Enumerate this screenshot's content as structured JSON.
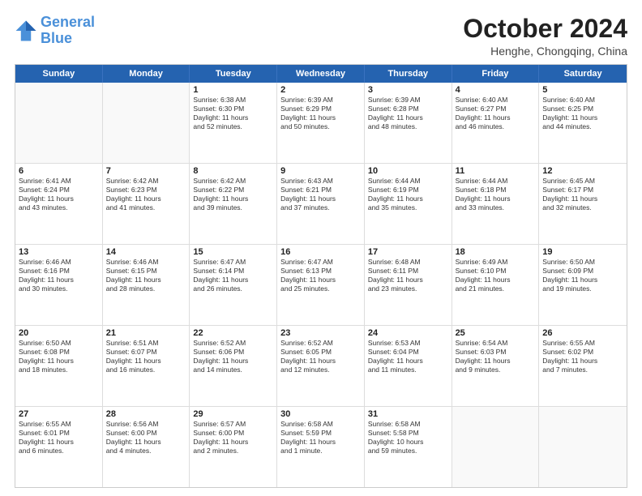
{
  "logo": {
    "general": "General",
    "blue": "Blue"
  },
  "title": "October 2024",
  "subtitle": "Henghe, Chongqing, China",
  "header_days": [
    "Sunday",
    "Monday",
    "Tuesday",
    "Wednesday",
    "Thursday",
    "Friday",
    "Saturday"
  ],
  "weeks": [
    [
      {
        "day": "",
        "lines": []
      },
      {
        "day": "",
        "lines": []
      },
      {
        "day": "1",
        "lines": [
          "Sunrise: 6:38 AM",
          "Sunset: 6:30 PM",
          "Daylight: 11 hours",
          "and 52 minutes."
        ]
      },
      {
        "day": "2",
        "lines": [
          "Sunrise: 6:39 AM",
          "Sunset: 6:29 PM",
          "Daylight: 11 hours",
          "and 50 minutes."
        ]
      },
      {
        "day": "3",
        "lines": [
          "Sunrise: 6:39 AM",
          "Sunset: 6:28 PM",
          "Daylight: 11 hours",
          "and 48 minutes."
        ]
      },
      {
        "day": "4",
        "lines": [
          "Sunrise: 6:40 AM",
          "Sunset: 6:27 PM",
          "Daylight: 11 hours",
          "and 46 minutes."
        ]
      },
      {
        "day": "5",
        "lines": [
          "Sunrise: 6:40 AM",
          "Sunset: 6:25 PM",
          "Daylight: 11 hours",
          "and 44 minutes."
        ]
      }
    ],
    [
      {
        "day": "6",
        "lines": [
          "Sunrise: 6:41 AM",
          "Sunset: 6:24 PM",
          "Daylight: 11 hours",
          "and 43 minutes."
        ]
      },
      {
        "day": "7",
        "lines": [
          "Sunrise: 6:42 AM",
          "Sunset: 6:23 PM",
          "Daylight: 11 hours",
          "and 41 minutes."
        ]
      },
      {
        "day": "8",
        "lines": [
          "Sunrise: 6:42 AM",
          "Sunset: 6:22 PM",
          "Daylight: 11 hours",
          "and 39 minutes."
        ]
      },
      {
        "day": "9",
        "lines": [
          "Sunrise: 6:43 AM",
          "Sunset: 6:21 PM",
          "Daylight: 11 hours",
          "and 37 minutes."
        ]
      },
      {
        "day": "10",
        "lines": [
          "Sunrise: 6:44 AM",
          "Sunset: 6:19 PM",
          "Daylight: 11 hours",
          "and 35 minutes."
        ]
      },
      {
        "day": "11",
        "lines": [
          "Sunrise: 6:44 AM",
          "Sunset: 6:18 PM",
          "Daylight: 11 hours",
          "and 33 minutes."
        ]
      },
      {
        "day": "12",
        "lines": [
          "Sunrise: 6:45 AM",
          "Sunset: 6:17 PM",
          "Daylight: 11 hours",
          "and 32 minutes."
        ]
      }
    ],
    [
      {
        "day": "13",
        "lines": [
          "Sunrise: 6:46 AM",
          "Sunset: 6:16 PM",
          "Daylight: 11 hours",
          "and 30 minutes."
        ]
      },
      {
        "day": "14",
        "lines": [
          "Sunrise: 6:46 AM",
          "Sunset: 6:15 PM",
          "Daylight: 11 hours",
          "and 28 minutes."
        ]
      },
      {
        "day": "15",
        "lines": [
          "Sunrise: 6:47 AM",
          "Sunset: 6:14 PM",
          "Daylight: 11 hours",
          "and 26 minutes."
        ]
      },
      {
        "day": "16",
        "lines": [
          "Sunrise: 6:47 AM",
          "Sunset: 6:13 PM",
          "Daylight: 11 hours",
          "and 25 minutes."
        ]
      },
      {
        "day": "17",
        "lines": [
          "Sunrise: 6:48 AM",
          "Sunset: 6:11 PM",
          "Daylight: 11 hours",
          "and 23 minutes."
        ]
      },
      {
        "day": "18",
        "lines": [
          "Sunrise: 6:49 AM",
          "Sunset: 6:10 PM",
          "Daylight: 11 hours",
          "and 21 minutes."
        ]
      },
      {
        "day": "19",
        "lines": [
          "Sunrise: 6:50 AM",
          "Sunset: 6:09 PM",
          "Daylight: 11 hours",
          "and 19 minutes."
        ]
      }
    ],
    [
      {
        "day": "20",
        "lines": [
          "Sunrise: 6:50 AM",
          "Sunset: 6:08 PM",
          "Daylight: 11 hours",
          "and 18 minutes."
        ]
      },
      {
        "day": "21",
        "lines": [
          "Sunrise: 6:51 AM",
          "Sunset: 6:07 PM",
          "Daylight: 11 hours",
          "and 16 minutes."
        ]
      },
      {
        "day": "22",
        "lines": [
          "Sunrise: 6:52 AM",
          "Sunset: 6:06 PM",
          "Daylight: 11 hours",
          "and 14 minutes."
        ]
      },
      {
        "day": "23",
        "lines": [
          "Sunrise: 6:52 AM",
          "Sunset: 6:05 PM",
          "Daylight: 11 hours",
          "and 12 minutes."
        ]
      },
      {
        "day": "24",
        "lines": [
          "Sunrise: 6:53 AM",
          "Sunset: 6:04 PM",
          "Daylight: 11 hours",
          "and 11 minutes."
        ]
      },
      {
        "day": "25",
        "lines": [
          "Sunrise: 6:54 AM",
          "Sunset: 6:03 PM",
          "Daylight: 11 hours",
          "and 9 minutes."
        ]
      },
      {
        "day": "26",
        "lines": [
          "Sunrise: 6:55 AM",
          "Sunset: 6:02 PM",
          "Daylight: 11 hours",
          "and 7 minutes."
        ]
      }
    ],
    [
      {
        "day": "27",
        "lines": [
          "Sunrise: 6:55 AM",
          "Sunset: 6:01 PM",
          "Daylight: 11 hours",
          "and 6 minutes."
        ]
      },
      {
        "day": "28",
        "lines": [
          "Sunrise: 6:56 AM",
          "Sunset: 6:00 PM",
          "Daylight: 11 hours",
          "and 4 minutes."
        ]
      },
      {
        "day": "29",
        "lines": [
          "Sunrise: 6:57 AM",
          "Sunset: 6:00 PM",
          "Daylight: 11 hours",
          "and 2 minutes."
        ]
      },
      {
        "day": "30",
        "lines": [
          "Sunrise: 6:58 AM",
          "Sunset: 5:59 PM",
          "Daylight: 11 hours",
          "and 1 minute."
        ]
      },
      {
        "day": "31",
        "lines": [
          "Sunrise: 6:58 AM",
          "Sunset: 5:58 PM",
          "Daylight: 10 hours",
          "and 59 minutes."
        ]
      },
      {
        "day": "",
        "lines": []
      },
      {
        "day": "",
        "lines": []
      }
    ]
  ]
}
